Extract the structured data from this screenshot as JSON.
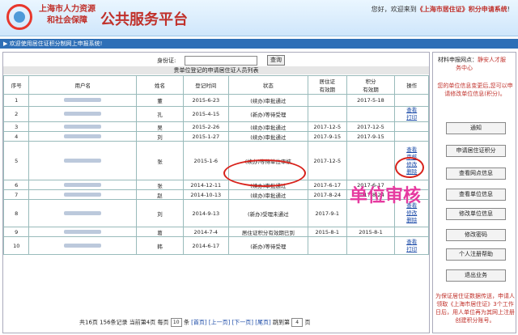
{
  "header": {
    "org_line1": "上海市人力资源",
    "org_line2": "和社会保障",
    "platform": "公共服务平台",
    "welcome_prefix": "您好，欢迎来到",
    "welcome_site": "《上海市居住证》积分申请系统",
    "welcome_suffix": "!"
  },
  "subbar": "▶ 欢迎使用居住证积分制网上申报系统!",
  "search": {
    "label": "身份证:",
    "value": "",
    "button": "查询"
  },
  "table": {
    "title": "贵单位登记的申请居住证人员列表",
    "headers": [
      "序号",
      "用户名",
      "姓名",
      "登记时间",
      "状态",
      "居住证\n有效期",
      "积分\n有效期",
      "操作"
    ],
    "rows": [
      {
        "no": "1",
        "name": "董",
        "reg": "2015-6-23",
        "status": "(续办)审批通过",
        "res": "",
        "pts": "2017-5-18",
        "pts2": "2017-5-18",
        "ops": []
      },
      {
        "no": "2",
        "name": "孔",
        "reg": "2015-4-15",
        "status": "(新办)等待受理",
        "res": "",
        "pts": "",
        "pts2": "",
        "ops": [
          "查看",
          "打印"
        ]
      },
      {
        "no": "3",
        "name": "吴",
        "reg": "2015-2-26",
        "status": "(续办)审批通过",
        "res": "2017-12-5",
        "pts": "",
        "pts2": "2017-12-5",
        "ops": []
      },
      {
        "no": "4",
        "name": "刘",
        "reg": "2015-1-27",
        "status": "(续办)审批通过",
        "res": "2017-9-15",
        "pts": "",
        "pts2": "2017-9-15",
        "ops": []
      },
      {
        "no": "5",
        "name": "张",
        "reg": "2015-1-6",
        "status": "(续办)等待单位审核",
        "res": "2017-12-5",
        "pts": "",
        "pts2": "",
        "ops": [
          "查看",
          "审核",
          "修改",
          "删除"
        ]
      },
      {
        "no": "6",
        "name": "张",
        "reg": "2014-12-11",
        "status": "(续办)审批通过",
        "res": "2017-6-17",
        "pts": "",
        "pts2": "2017-6-17",
        "ops": []
      },
      {
        "no": "7",
        "name": "赵",
        "reg": "2014-10-13",
        "status": "(续办)审批通过",
        "res": "2017-8-24",
        "pts": "",
        "pts2": "2017-8-24",
        "ops": []
      },
      {
        "no": "8",
        "name": "刘",
        "reg": "2014-9-13",
        "status": "(新办)受理未通过",
        "res": "2017-9-1",
        "pts": "",
        "pts2": "",
        "ops": [
          "查看",
          "修改",
          "删除"
        ]
      },
      {
        "no": "9",
        "name": "葛",
        "reg": "2014-7-4",
        "status": "居住证积分有效期已到",
        "res": "2015-8-1",
        "pts": "",
        "pts2": "2015-8-1",
        "ops": []
      },
      {
        "no": "10",
        "name": "韩",
        "reg": "2014-6-17",
        "status": "(新办)等待受理",
        "res": "",
        "pts": "",
        "pts2": "",
        "ops": [
          "查看",
          "打印"
        ]
      }
    ]
  },
  "pager": {
    "total_pages": "共16页",
    "total_records": "156条记录",
    "current": "当前第4页",
    "per_page_label": "每页",
    "per_page": "10",
    "per_page_unit": "条",
    "first": "[首页]",
    "prev": "[上一页]",
    "next": "[下一页]",
    "last": "[尾页]",
    "goto_label": "跳到第",
    "goto_value": "4",
    "goto_unit": "页"
  },
  "annotation": "单位审核",
  "sidebar": {
    "site_label": "材料申报网点：",
    "site_value_1": "静安人才服",
    "site_value_2": "务中心",
    "hint": "您的单位信息变更后,您可以申请修改单位信息(积分)。",
    "buttons": [
      "通知",
      "申请居住证积分",
      "查看网点信息",
      "查看单位信息",
      "修改单位信息",
      "修改密码",
      "个人注册帮助",
      "退出业务"
    ],
    "bottom_note": "为保证居住证数据传送，申请人领取《上海市居住证》3个工作日后，用人单位再为其网上注册创建积分账号。"
  },
  "colors": {
    "accent": "#2e6fb7",
    "brand_red": "#c0302a",
    "annotation": "#e63aa0"
  }
}
